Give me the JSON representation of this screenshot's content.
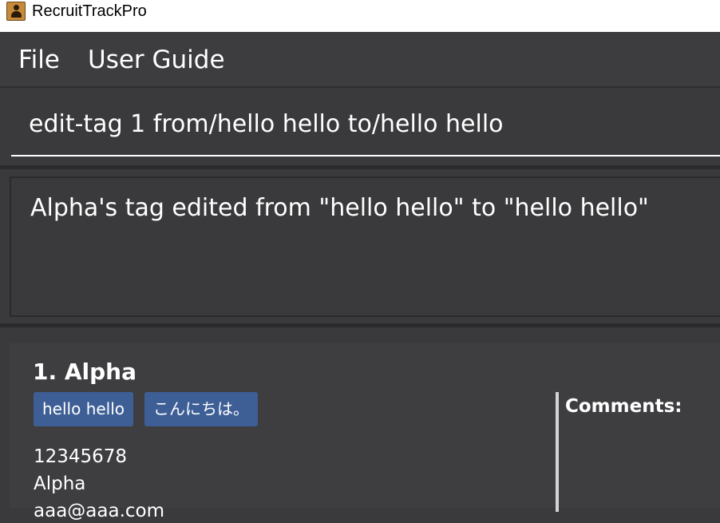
{
  "app": {
    "title": "RecruitTrackPro",
    "icon": "contact-book-icon"
  },
  "menu": {
    "items": [
      {
        "label": "File"
      },
      {
        "label": "User Guide"
      }
    ]
  },
  "command": {
    "value": "edit-tag 1 from/hello hello to/hello hello"
  },
  "result": {
    "message": "Alpha's tag edited from \"hello hello\" to \"hello hello\""
  },
  "persons": [
    {
      "index_name": "1. Alpha",
      "tags": [
        "hello hello",
        "こんにちは。"
      ],
      "phone": "12345678",
      "address": "Alpha",
      "email": "aaa@aaa.com",
      "comments_label": "Comments:"
    }
  ],
  "colors": {
    "background": "#3a3a3c",
    "tag": "#3e5f96",
    "text": "#ffffff"
  }
}
